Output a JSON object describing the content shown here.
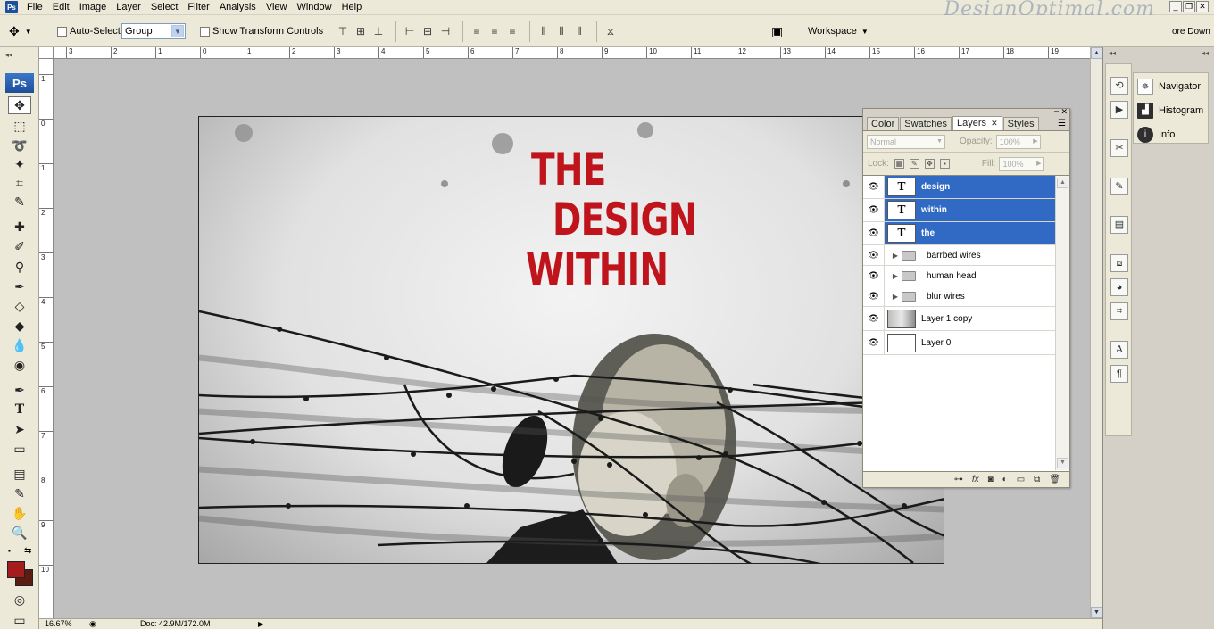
{
  "menu": [
    "File",
    "Edit",
    "Image",
    "Layer",
    "Select",
    "Filter",
    "Analysis",
    "View",
    "Window",
    "Help"
  ],
  "watermark": "DesignOptimal.com",
  "restore_label": "ore Down",
  "options": {
    "auto_select": "Auto-Select:",
    "auto_select_value": "Group",
    "show_transform": "Show Transform Controls",
    "workspace": "Workspace"
  },
  "rulers": {
    "h": [
      "3",
      "2",
      "1",
      "0",
      "1",
      "2",
      "3",
      "4",
      "5",
      "6",
      "7",
      "8",
      "9",
      "10",
      "11",
      "12",
      "13",
      "14",
      "15",
      "16",
      "17",
      "18",
      "19"
    ],
    "v": [
      "1",
      "0",
      "1",
      "2",
      "3",
      "4",
      "5",
      "6",
      "7",
      "8",
      "9",
      "10"
    ]
  },
  "canvas": {
    "title": [
      "THE",
      "DESIGN",
      "WITHIN"
    ],
    "title_color": "#c0141c"
  },
  "status": {
    "zoom": "16.67%",
    "doc": "Doc: 42.9M/172.0M"
  },
  "panel": {
    "tabs": [
      "Color",
      "Swatches",
      "Layers",
      "Styles"
    ],
    "active_tab": "Layers",
    "blend_mode": "Normal",
    "opacity_label": "Opacity:",
    "opacity_value": "100%",
    "lock_label": "Lock:",
    "fill_label": "Fill:",
    "fill_value": "100%",
    "layers": [
      {
        "name": "design",
        "kind": "text",
        "selected": true
      },
      {
        "name": "within",
        "kind": "text",
        "selected": true
      },
      {
        "name": "the",
        "kind": "text",
        "selected": true
      },
      {
        "name": "barrbed wires",
        "kind": "group",
        "selected": false
      },
      {
        "name": "human head",
        "kind": "group",
        "selected": false
      },
      {
        "name": "blur wires",
        "kind": "group",
        "selected": false
      },
      {
        "name": "Layer 1 copy",
        "kind": "image",
        "selected": false
      },
      {
        "name": "Layer 0",
        "kind": "image",
        "selected": false
      }
    ]
  },
  "dock": {
    "palettes": [
      "Navigator",
      "Histogram",
      "Info"
    ]
  },
  "colors": {
    "foreground": "#a51c1c",
    "background": "#5b1c12",
    "selection": "#316ac5"
  }
}
